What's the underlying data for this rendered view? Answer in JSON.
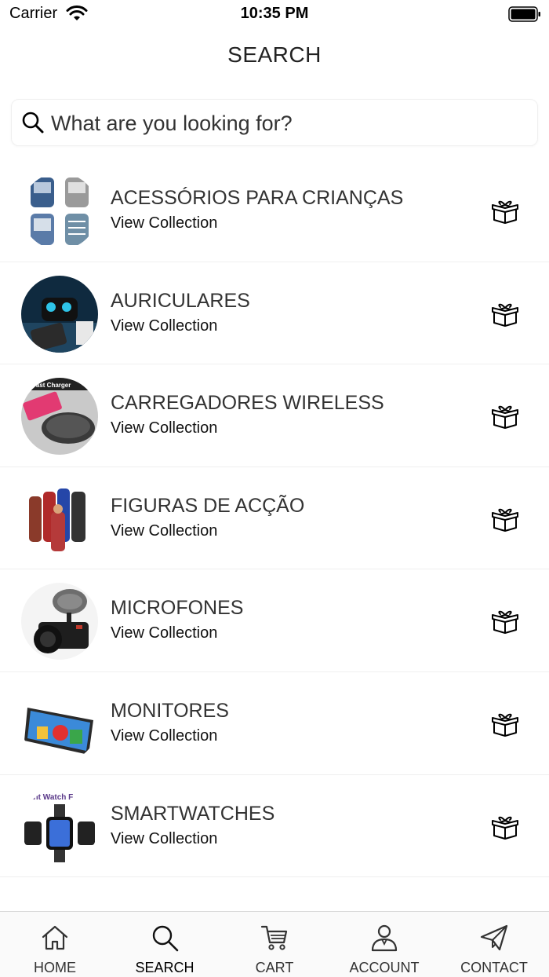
{
  "status_bar": {
    "carrier": "Carrier",
    "time": "10:35 PM"
  },
  "header": {
    "title": "SEARCH"
  },
  "search": {
    "placeholder": "What are you looking for?"
  },
  "collections": [
    {
      "title": "ACESSÓRIOS PARA CRIANÇAS",
      "subtitle": "View Collection",
      "image": "kids-car-seats"
    },
    {
      "title": "AURICULARES",
      "subtitle": "View Collection",
      "image": "earbuds-case"
    },
    {
      "title": "CARREGADORES WIRELESS",
      "subtitle": "View Collection",
      "image": "wireless-charger",
      "image_text": "Fast Charger"
    },
    {
      "title": "FIGURAS DE ACÇÃO",
      "subtitle": "View Collection",
      "image": "action-figures"
    },
    {
      "title": "MICROFONES",
      "subtitle": "View Collection",
      "image": "camera-microphone"
    },
    {
      "title": "MONITORES",
      "subtitle": "View Collection",
      "image": "portable-monitor"
    },
    {
      "title": "SMARTWATCHES",
      "subtitle": "View Collection",
      "image": "smartwatches",
      "image_text": "ant Watch F"
    }
  ],
  "tabs": [
    {
      "label": "HOME",
      "icon": "home-icon"
    },
    {
      "label": "SEARCH",
      "icon": "search-icon",
      "active": true
    },
    {
      "label": "CART",
      "icon": "cart-icon"
    },
    {
      "label": "ACCOUNT",
      "icon": "account-icon"
    },
    {
      "label": "CONTACT",
      "icon": "paper-plane-icon"
    }
  ],
  "colors": {
    "background": "#ffffff",
    "text": "#333333",
    "divider": "#efefef",
    "tab_bar": "#fafafa"
  }
}
